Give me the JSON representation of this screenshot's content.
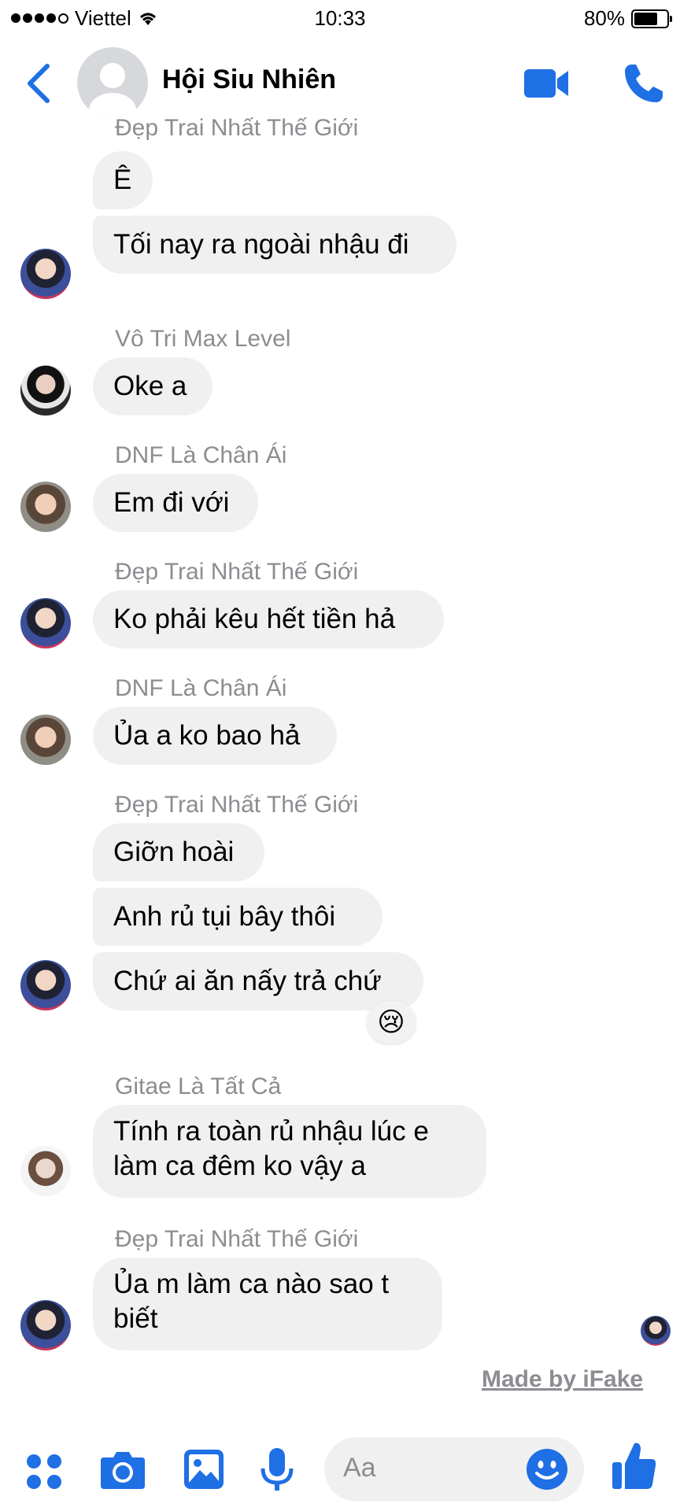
{
  "status_bar": {
    "carrier": "Viettel",
    "time": "10:33",
    "battery": "80%",
    "battery_level": 0.8
  },
  "header": {
    "title": "Hội Siu Nhiên"
  },
  "colors": {
    "accent": "#1f6fe5",
    "bubble": "#f0f0f0",
    "meta": "#8b8d91"
  },
  "messages": [
    {
      "sender": "Đẹp Trai Nhất Thế Giới",
      "texts": [
        "Ê",
        "Tối nay ra ngoài nhậu đi"
      ]
    },
    {
      "sender": "Vô Tri Max Level",
      "texts": [
        "Oke a"
      ]
    },
    {
      "sender": "DNF Là Chân Ái",
      "texts": [
        "Em đi với"
      ]
    },
    {
      "sender": "Đẹp Trai Nhất Thế Giới",
      "texts": [
        "Ko phải kêu hết tiền hả"
      ]
    },
    {
      "sender": "DNF Là Chân Ái",
      "texts": [
        "Ủa a ko bao hả"
      ]
    },
    {
      "sender": "Đẹp Trai Nhất Thế Giới",
      "texts": [
        "Giỡn hoài",
        "Anh rủ tụi bây thôi",
        "Chứ ai ăn nấy trả chứ"
      ],
      "reaction": "😢"
    },
    {
      "sender": "Gitae Là Tất Cả",
      "texts": [
        "Tính ra toàn rủ nhậu lúc e\nlàm ca đêm ko vậy a"
      ]
    },
    {
      "sender": "Đẹp Trai Nhất Thế Giới",
      "texts": [
        "Ủa m làm ca nào sao t\nbiết"
      ]
    }
  ],
  "watermark": "Made by iFake",
  "composer": {
    "placeholder": "Aa"
  },
  "icons": [
    "back-chevron-icon",
    "video-camera-icon",
    "phone-icon",
    "apps-icon",
    "camera-icon",
    "photo-icon",
    "microphone-icon",
    "smiley-icon",
    "thumbs-up-icon"
  ]
}
